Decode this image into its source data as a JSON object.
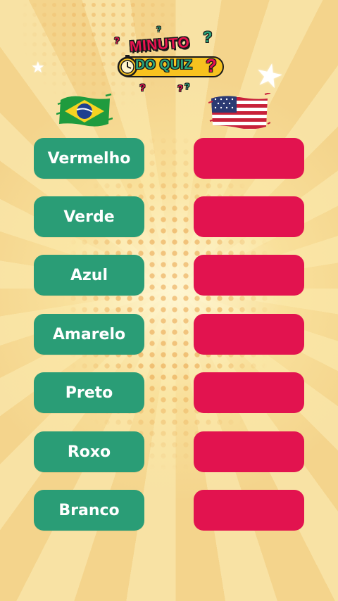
{
  "header": {
    "logo_line1": "MINUTO",
    "logo_line2": "DO QUIZ",
    "logo_q": "?"
  },
  "flags": {
    "left": "brazil-flag",
    "right": "usa-flag"
  },
  "colors": {
    "left_button": "#2a9d76",
    "right_button": "#e2134f",
    "background": "#f6dc95"
  },
  "words": [
    {
      "pt": "Vermelho",
      "en": ""
    },
    {
      "pt": "Verde",
      "en": ""
    },
    {
      "pt": "Azul",
      "en": ""
    },
    {
      "pt": "Amarelo",
      "en": ""
    },
    {
      "pt": "Preto",
      "en": ""
    },
    {
      "pt": "Roxo",
      "en": ""
    },
    {
      "pt": "Branco",
      "en": ""
    }
  ]
}
